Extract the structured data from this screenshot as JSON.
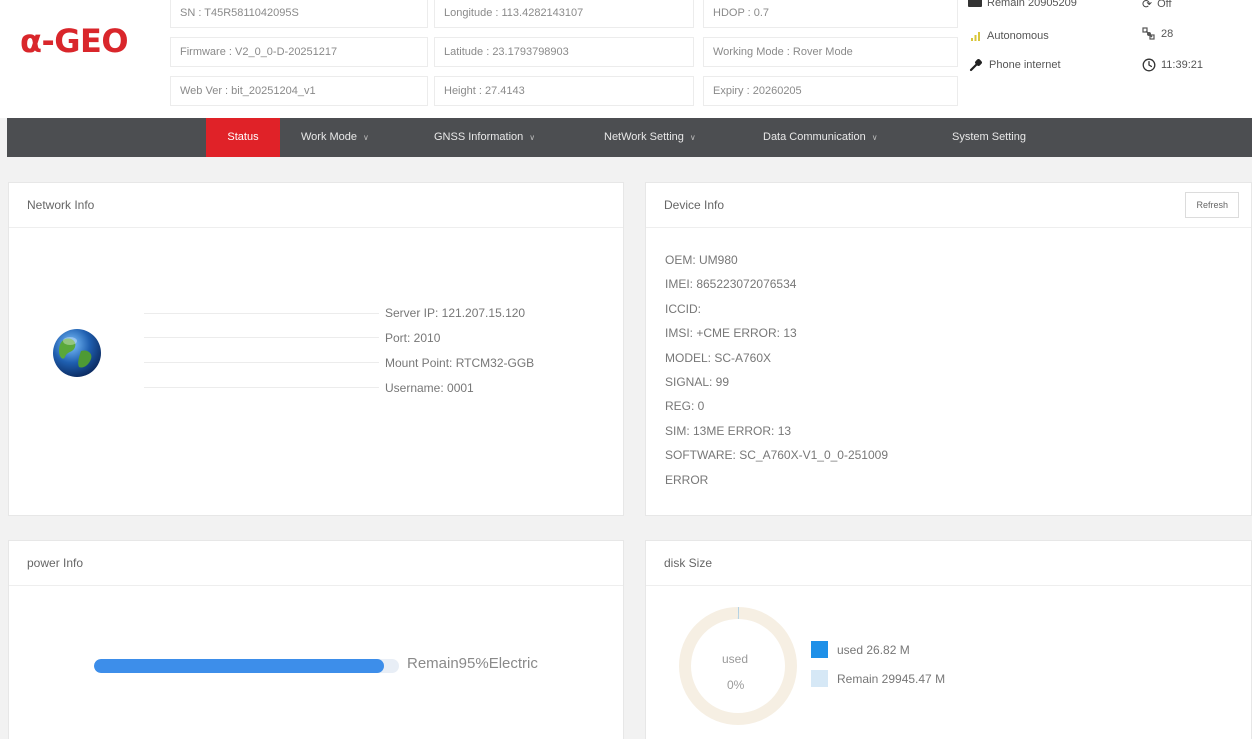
{
  "brand": {
    "logo_text": "α-GEO"
  },
  "info": {
    "sn": "SN : T45R5811042095S",
    "longitude": "Longitude : 113.4282143107",
    "hdop": "HDOP : 0.7",
    "firmware": "Firmware : V2_0_0-D-20251217",
    "latitude": "Latitude : 23.1793798903",
    "working_mode": "Working Mode : Rover Mode",
    "webver": "Web Ver : bit_20251204_v1",
    "height": "Height : 27.4143",
    "expiry": "Expiry : 20260205"
  },
  "status": {
    "remain_partial": "Remain 20905209",
    "solution": "Autonomous",
    "link": "Phone internet",
    "top_right_partial": "Off",
    "satellites": "28",
    "time": "11:39:21"
  },
  "nav": {
    "items": [
      {
        "label": "Status",
        "dropdown": false
      },
      {
        "label": "Work Mode",
        "dropdown": true
      },
      {
        "label": "GNSS Information",
        "dropdown": true
      },
      {
        "label": "NetWork Setting",
        "dropdown": true
      },
      {
        "label": "Data Communication",
        "dropdown": true
      },
      {
        "label": "System Setting",
        "dropdown": false
      }
    ]
  },
  "network_info": {
    "title": "Network Info",
    "server_ip": "Server IP: 121.207.15.120",
    "port": "Port: 2010",
    "mount_point": "Mount Point: RTCM32-GGB",
    "username": "Username: 0001"
  },
  "device_info": {
    "title": "Device Info",
    "refresh_label": "Refresh",
    "lines": [
      "OEM: UM980",
      "IMEI: 865223072076534",
      "ICCID:",
      "IMSI: +CME ERROR: 13",
      "MODEL: SC-A760X",
      "SIGNAL: 99",
      "REG: 0",
      "SIM: 13ME ERROR: 13",
      "SOFTWARE: SC_A760X-V1_0_0-251009",
      "ERROR"
    ]
  },
  "power_info": {
    "title": "power Info",
    "remain_percent": 95,
    "label": "Remain95%Electric"
  },
  "disk_size": {
    "title": "disk Size",
    "donut_label": "used",
    "donut_percent": "0%",
    "used_fraction": 0.0009,
    "legend_used": "used 26.82 M",
    "legend_remain": "Remain 29945.47 M"
  },
  "colors": {
    "brand_red": "#d9262b",
    "nav_bg": "#4c4e51",
    "nav_active": "#e02228",
    "progress_blue": "#3d8eea",
    "used_blue": "#1e90e8",
    "remain_light": "#d6e8f6"
  }
}
